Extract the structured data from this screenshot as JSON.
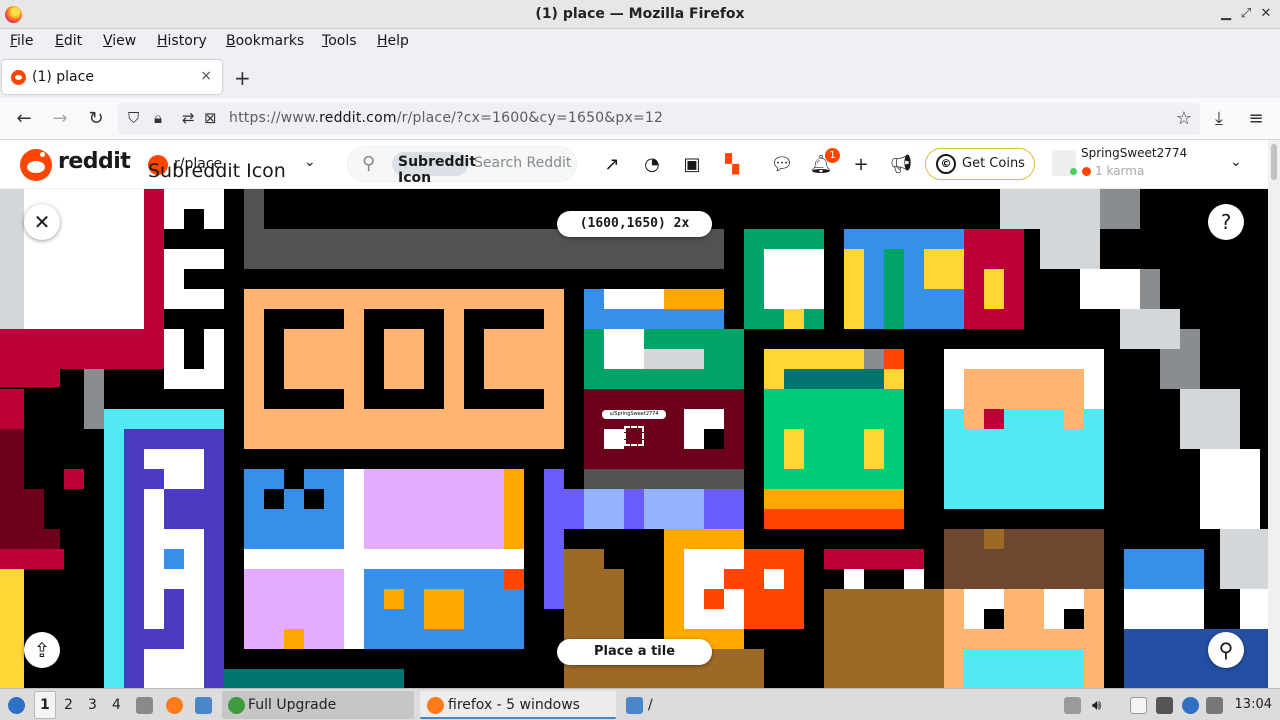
{
  "window": {
    "title": "(1) place — Mozilla Firefox"
  },
  "menu": [
    {
      "label": "File",
      "key": "F",
      "rest": "ile"
    },
    {
      "label": "Edit",
      "key": "E",
      "rest": "dit"
    },
    {
      "label": "View",
      "key": "V",
      "rest": "iew"
    },
    {
      "label": "History",
      "key": "H",
      "rest": "istory"
    },
    {
      "label": "Bookmarks",
      "key": "B",
      "rest": "ookmarks"
    },
    {
      "label": "Tools",
      "key": "T",
      "rest": "ools"
    },
    {
      "label": "Help",
      "key": "H",
      "rest": "elp"
    }
  ],
  "tab": {
    "label": "(1) place",
    "close": "×",
    "new_tab": "+"
  },
  "nav": {
    "url_prefix": "https://www.",
    "url_host": "reddit.com",
    "url_path": "/r/place/?cx=1600&cy=1650&px=12"
  },
  "reddit": {
    "wordmark": "reddit",
    "subreddit_name": "r/place",
    "subreddit_icon_alt": "Subreddit Icon",
    "search_chip_alt": "Subreddit Icon",
    "search_chip_text": "r/place",
    "search_placeholder": "Search Reddit",
    "notification_count": "1",
    "get_coins": "Get Coins",
    "coin_glyph": "©",
    "username": "SpringSweet2774",
    "karma": "1 karma"
  },
  "place": {
    "coordinates": "(1600,1650) 2x",
    "place_button": "Place a tile",
    "user_tag": "u/SpringSweet2774"
  },
  "taskbar": {
    "workspaces": [
      "1",
      "2",
      "3",
      "4"
    ],
    "active_workspace": "1",
    "tasks": [
      "Full Upgrade",
      "firefox - 5 windows",
      "/"
    ],
    "clock": "13:04"
  },
  "colors": {
    "reddit_orange": "#ff4500",
    "canvas_black": "#000000",
    "coins_border": "#ddbd37"
  }
}
